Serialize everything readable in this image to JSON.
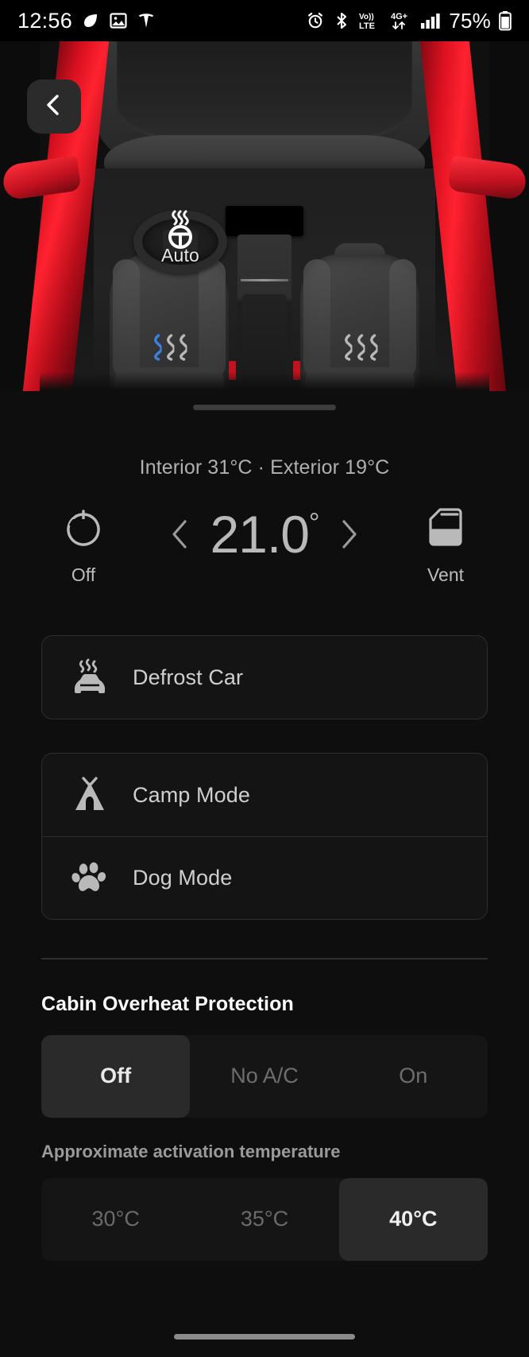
{
  "statusbar": {
    "time": "12:56",
    "battery": "75%",
    "left_icons": [
      "leaf-icon",
      "photo-icon",
      "tesla-icon"
    ],
    "right_icons": [
      "alarm-icon",
      "bluetooth-icon",
      "volte-icon",
      "4g-plus-icon",
      "signal-bars-icon",
      "battery-icon"
    ],
    "network_volte": "Vo))",
    "network_lte": "LTE",
    "network_4g": "4G+"
  },
  "hero": {
    "back_button": "back-chevron-icon",
    "steering_wheel_heater": {
      "icon": "steering-wheel-heat-icon",
      "label": "Auto"
    },
    "driver_seat_heater": {
      "icon": "seat-heat-icon",
      "active_waves": 1,
      "total_waves": 3
    },
    "passenger_seat_heater": {
      "icon": "seat-heat-icon",
      "active_waves": 0,
      "total_waves": 3
    },
    "colors": {
      "car_accent": "#d9101f",
      "heat_active": "#3b82e0",
      "heat_inactive": "#b8b8b8"
    }
  },
  "climate": {
    "temps_summary": "Interior 31°C  ·  Exterior 19°C",
    "power": {
      "icon": "power-icon",
      "label": "Off"
    },
    "fan": {
      "icon": "vent-icon",
      "label": "Vent"
    },
    "decrease": "chevron-left-icon",
    "increase": "chevron-right-icon",
    "target_temp": "21.0",
    "degree_symbol": "°"
  },
  "actions": [
    {
      "label": "Defrost Car",
      "icon": "defrost-car-icon"
    },
    {
      "label": "Camp Mode",
      "icon": "tent-icon"
    },
    {
      "label": "Dog Mode",
      "icon": "paw-icon"
    }
  ],
  "overheat": {
    "title": "Cabin Overheat Protection",
    "modes": [
      "Off",
      "No A/C",
      "On"
    ],
    "selected_mode": "Off",
    "sub_label": "Approximate activation temperature",
    "temperatures": [
      "30°C",
      "35°C",
      "40°C"
    ],
    "selected_temperature": "40°C"
  },
  "navbar": {
    "handle": "home-indicator"
  }
}
